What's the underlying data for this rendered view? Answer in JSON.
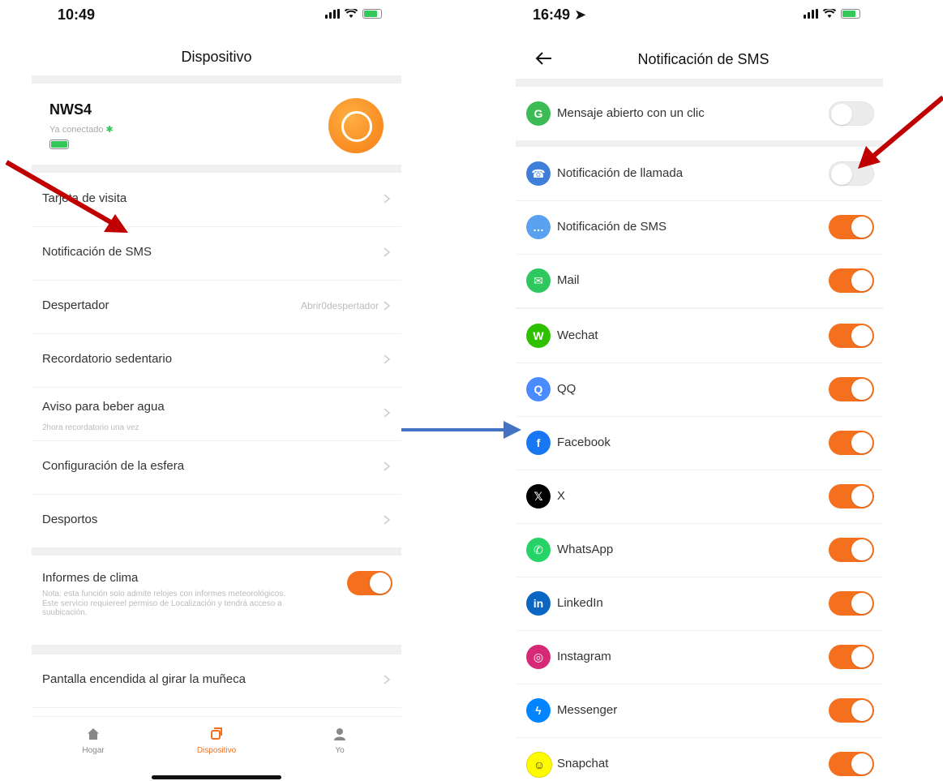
{
  "left": {
    "status_time": "10:49",
    "title": "Dispositivo",
    "device": {
      "name": "NWS4",
      "status": "Ya conectado"
    },
    "items": [
      {
        "label": "Tarjeta de visita",
        "sub": "",
        "value": ""
      },
      {
        "label": "Notificación de SMS",
        "sub": "",
        "value": ""
      },
      {
        "label": "Despertador",
        "sub": "",
        "value": "Abrir0despertador"
      },
      {
        "label": "Recordatorio sedentario",
        "sub": "",
        "value": ""
      },
      {
        "label": "Aviso para beber agua",
        "sub": "2hora recordatorio una vez",
        "value": ""
      },
      {
        "label": "Configuración de la esfera",
        "sub": "",
        "value": ""
      },
      {
        "label": "Desportos",
        "sub": "",
        "value": ""
      }
    ],
    "weather": {
      "label": "Informes de clima",
      "note": "Nota: esta función solo admite relojes con informes meteorológicos.\nEste servicio requiereel permiso de Localización y tendrá acceso a suubicación.",
      "on": true
    },
    "wrist": {
      "label": "Pantalla encendida al girar la muñeca"
    },
    "tabs": [
      {
        "label": "Hogar",
        "icon": "home-icon",
        "active": false
      },
      {
        "label": "Dispositivo",
        "icon": "device-icon",
        "active": true
      },
      {
        "label": "Yo",
        "icon": "person-icon",
        "active": false
      }
    ]
  },
  "right": {
    "status_time": "16:49",
    "title": "Notificación de SMS",
    "items": [
      {
        "label": "Mensaje abierto con un clic",
        "icon": "one-click-icon",
        "color": "#3cba54",
        "glyph": "G",
        "on": false
      },
      {
        "label": "Notificación de llamada",
        "icon": "phone-icon",
        "color": "#3f7fd9",
        "glyph": "☎",
        "on": false
      },
      {
        "label": "Notificación de SMS",
        "icon": "sms-icon",
        "color": "#5aa2f0",
        "glyph": "…",
        "on": true
      },
      {
        "label": "Mail",
        "icon": "mail-icon",
        "color": "#2fc85f",
        "glyph": "✉",
        "on": true
      },
      {
        "label": "Wechat",
        "icon": "wechat-icon",
        "color": "#2dc100",
        "glyph": "W",
        "on": true
      },
      {
        "label": "QQ",
        "icon": "qq-icon",
        "color": "#4a8cff",
        "glyph": "Q",
        "on": true
      },
      {
        "label": "Facebook",
        "icon": "facebook-icon",
        "color": "#1877f2",
        "glyph": "f",
        "on": true
      },
      {
        "label": "X",
        "icon": "x-icon",
        "color": "#000000",
        "glyph": "𝕏",
        "on": true
      },
      {
        "label": "WhatsApp",
        "icon": "whatsapp-icon",
        "color": "#25d366",
        "glyph": "✆",
        "on": true
      },
      {
        "label": "LinkedIn",
        "icon": "linkedin-icon",
        "color": "#0a66c2",
        "glyph": "in",
        "on": true
      },
      {
        "label": "Instagram",
        "icon": "instagram-icon",
        "color": "#d62976",
        "glyph": "◎",
        "on": true
      },
      {
        "label": "Messenger",
        "icon": "messenger-icon",
        "color": "#0084ff",
        "glyph": "ϟ",
        "on": true
      },
      {
        "label": "Snapchat",
        "icon": "snapchat-icon",
        "color": "#fffc00",
        "glyph": "☺",
        "on": true
      }
    ]
  },
  "colors": {
    "accent": "#f5701e",
    "annotation_red": "#c00000",
    "annotation_blue": "#4472c4"
  }
}
